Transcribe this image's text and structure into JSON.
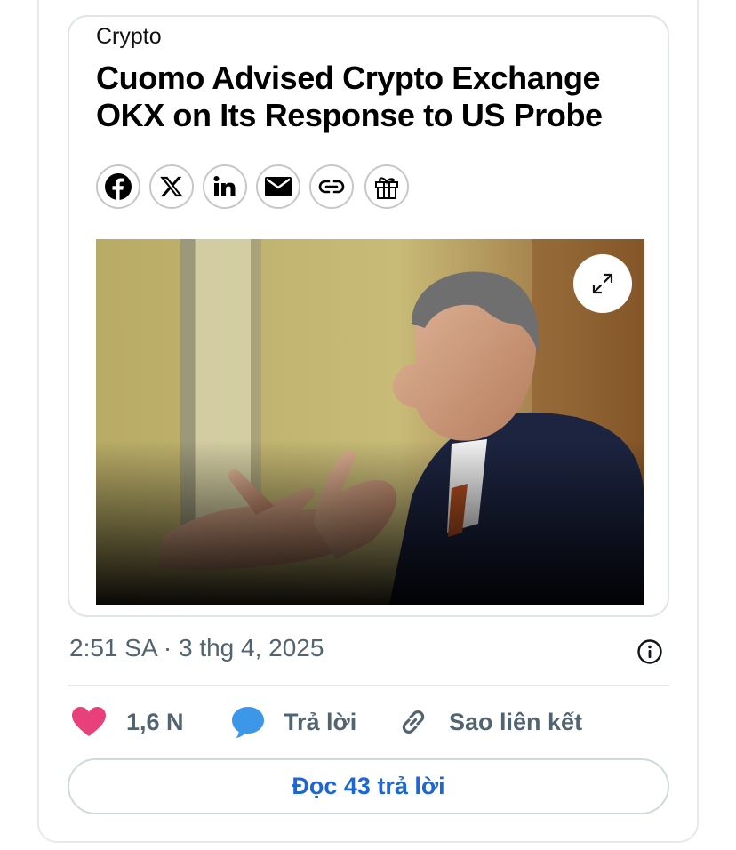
{
  "article": {
    "category": "Crypto",
    "headline": "Cuomo Advised Crypto Exchange OKX on Its Response to US Probe",
    "share_icons": [
      "facebook-icon",
      "x-icon",
      "linkedin-icon",
      "mail-icon",
      "link-icon",
      "gift-icon"
    ],
    "expand_icon": "expand-icon"
  },
  "post": {
    "timestamp": "2:51 SA · 3 thg 4, 2025",
    "info_icon": "info-icon"
  },
  "actions": {
    "like_count": "1,6 N",
    "reply_label": "Trả lời",
    "copy_link_label": "Sao liên kết",
    "read_replies_label": "Đọc 43 trả lời"
  },
  "colors": {
    "like": "#e8407a",
    "reply": "#3d97e8",
    "link": "#1d66d6",
    "muted": "#536471"
  }
}
